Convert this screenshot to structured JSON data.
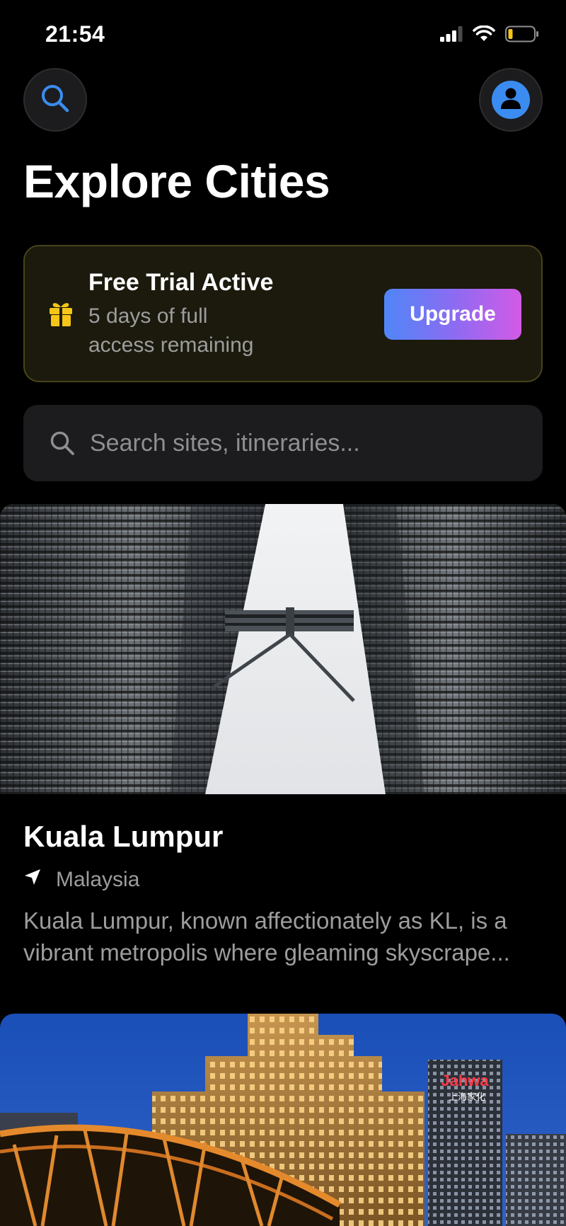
{
  "status_bar": {
    "time": "21:54",
    "icons": [
      "cellular-signal-icon",
      "wifi-icon",
      "battery-low-icon"
    ],
    "battery_color": "#f5c518"
  },
  "header": {
    "title": "Explore Cities",
    "search_button_icon": "search-icon",
    "profile_button_icon": "person-icon",
    "accent_color": "#3b8cf0"
  },
  "trial_banner": {
    "icon": "gift-icon",
    "icon_color": "#f5c518",
    "title": "Free Trial Active",
    "subtitle": "5 days of full access remaining",
    "upgrade_label": "Upgrade"
  },
  "search": {
    "placeholder": "Search sites, itineraries..."
  },
  "cities": [
    {
      "name": "Kuala Lumpur",
      "country": "Malaysia",
      "description": "Kuala Lumpur, known affectionately as KL, is a vibrant metropolis where gleaming skyscrape...",
      "image_content": "Petronas Twin Towers with skybridge",
      "location_icon": "location-arrow-icon"
    },
    {
      "image_content": "Night city skyline with illuminated historic building and steel bridge",
      "sign_text": "Jahwa",
      "sign_text_secondary": "上海家化"
    }
  ]
}
